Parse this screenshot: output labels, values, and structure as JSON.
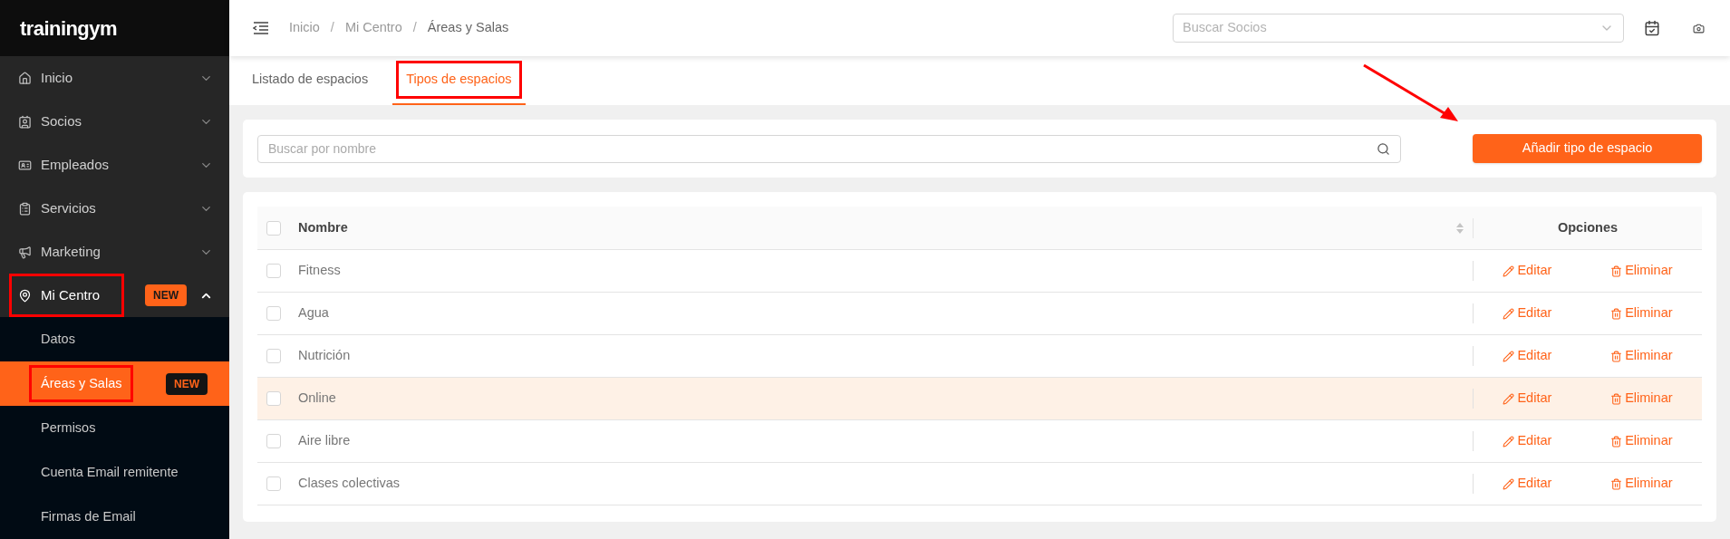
{
  "logo": "trainingym",
  "sidebar": {
    "items": [
      {
        "label": "Inicio",
        "expanded": false,
        "annotated": false
      },
      {
        "label": "Socios",
        "expanded": false,
        "annotated": false
      },
      {
        "label": "Empleados",
        "expanded": false,
        "annotated": false
      },
      {
        "label": "Servicios",
        "expanded": false,
        "annotated": false
      },
      {
        "label": "Marketing",
        "expanded": false,
        "annotated": false
      },
      {
        "label": "Mi Centro",
        "expanded": true,
        "annotated": true,
        "badge": "NEW",
        "children": [
          {
            "label": "Datos",
            "selected": false,
            "annotated": false
          },
          {
            "label": "Áreas y Salas",
            "selected": true,
            "annotated": true,
            "badge": "NEW"
          },
          {
            "label": "Permisos",
            "selected": false,
            "annotated": false
          },
          {
            "label": "Cuenta Email remitente",
            "selected": false,
            "annotated": false
          },
          {
            "label": "Firmas de Email",
            "selected": false,
            "annotated": false
          }
        ]
      }
    ]
  },
  "breadcrumb": [
    "Inicio",
    "Mi Centro",
    "Áreas y Salas"
  ],
  "breadcrumb_separator": "/",
  "member_search": {
    "placeholder": "Buscar Socios"
  },
  "tabs": [
    {
      "label": "Listado de espacios",
      "selected": false,
      "annotated": false
    },
    {
      "label": "Tipos de espacios",
      "selected": true,
      "annotated": true
    }
  ],
  "name_search": {
    "placeholder": "Buscar por nombre"
  },
  "add_button": {
    "label": "Añadir tipo de espacio",
    "annotated": true
  },
  "table": {
    "columns": [
      "Nombre",
      "Opciones"
    ],
    "all_checked": false,
    "rows": [
      {
        "name": "Fitness",
        "checked": false,
        "highlighted": false,
        "edit": "Editar",
        "delete": "Eliminar"
      },
      {
        "name": "Agua",
        "checked": false,
        "highlighted": false,
        "edit": "Editar",
        "delete": "Eliminar"
      },
      {
        "name": "Nutrición",
        "checked": false,
        "highlighted": false,
        "edit": "Editar",
        "delete": "Eliminar"
      },
      {
        "name": "Online",
        "checked": false,
        "highlighted": true,
        "edit": "Editar",
        "delete": "Eliminar"
      },
      {
        "name": "Aire libre",
        "checked": false,
        "highlighted": false,
        "edit": "Editar",
        "delete": "Eliminar"
      },
      {
        "name": "Clases colectivas",
        "checked": false,
        "highlighted": false,
        "edit": "Editar",
        "delete": "Eliminar"
      }
    ]
  }
}
